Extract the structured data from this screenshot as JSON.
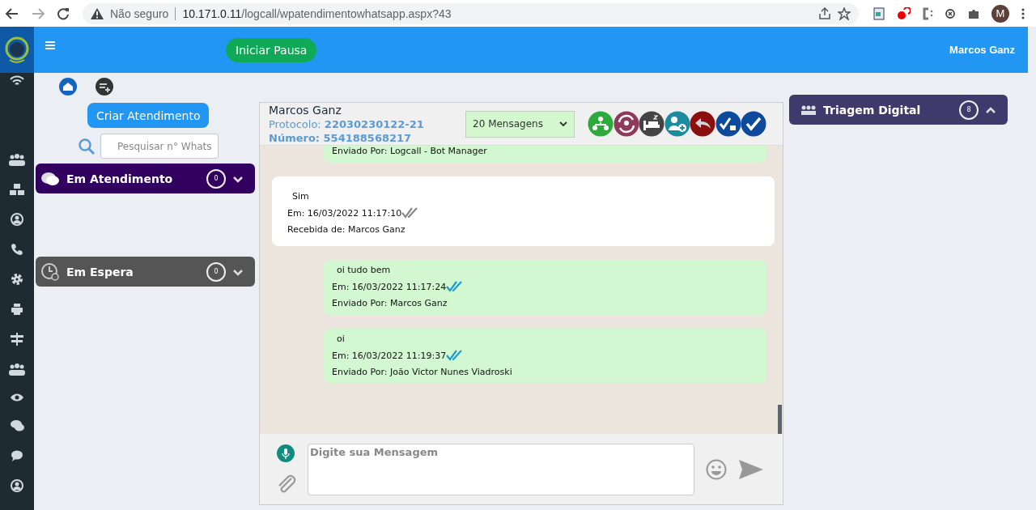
{
  "browser": {
    "security": "Não seguro",
    "url_host": "10.171.0.11",
    "url_path": "/logcall/wpatendimentowhatsapp.aspx?43",
    "avatar_letter": "M"
  },
  "header": {
    "pause_button": "Iniciar Pausa",
    "user": "Marcos Ganz"
  },
  "left": {
    "create_button": "Criar Atendimento",
    "search": {
      "placeholder": "Pesquisar n° Whats"
    },
    "queues": [
      {
        "title": "Em Atendimento",
        "count": "0",
        "expanded": false,
        "color": "#32005f",
        "kind": "chat"
      },
      {
        "title": "Em Espera",
        "count": "0",
        "expanded": false,
        "color": "#555555",
        "kind": "clock"
      }
    ]
  },
  "chat": {
    "contact": "Marcos Ganz",
    "protocol_label": "Protocolo:",
    "protocol": "22030230122-21",
    "number_label": "Número:",
    "number": "554188568217",
    "message_filter": "20 Mensagens",
    "messages": [
      {
        "kind": "sent",
        "from": "Enviado Por: Logcall - Bot Manager"
      },
      {
        "kind": "received",
        "text": "Sim",
        "time": "Em: 16/03/2022 11:17:10",
        "read": false,
        "from": "Recebida de: Marcos Ganz"
      },
      {
        "kind": "sent",
        "text": "oi tudo bem",
        "time": "Em: 16/03/2022 11:17:24",
        "read": true,
        "from": "Enviado Por: Marcos Ganz"
      },
      {
        "kind": "sent",
        "text": "oi",
        "time": "Em: 16/03/2022 11:19:37",
        "read": true,
        "from": "Enviado Por: João Victor Nunes Viadroski"
      }
    ],
    "composer": {
      "placeholder": "Digite sua Mensagem"
    }
  },
  "right": {
    "queues": [
      {
        "title": "Triagem Digital",
        "count": "8",
        "expanded": true,
        "color": "#3f3a6b",
        "kind": "group"
      }
    ]
  }
}
